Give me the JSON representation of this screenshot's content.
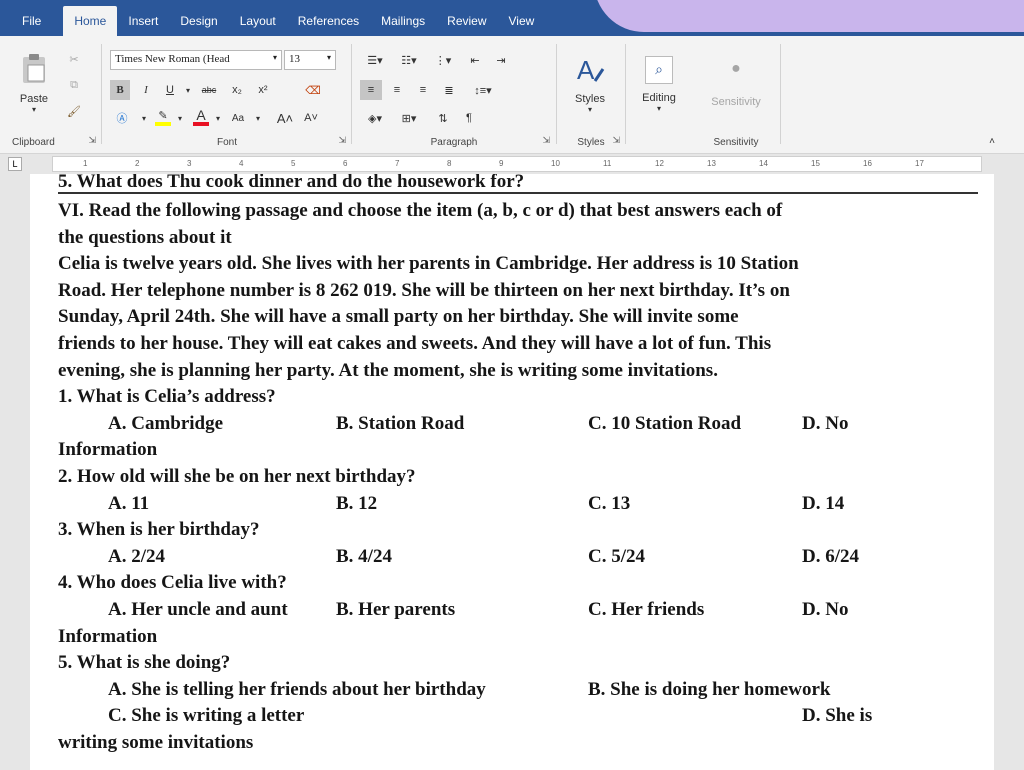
{
  "tabs": [
    "File",
    "Home",
    "Insert",
    "Design",
    "Layout",
    "References",
    "Mailings",
    "Review",
    "View"
  ],
  "ribbon": {
    "clipboard": {
      "paste_label": "Paste",
      "group_label": "Clipboard"
    },
    "font": {
      "font_name": "Times New Roman (Head",
      "font_size": "13",
      "group_label": "Font",
      "bold": "B",
      "italic": "I",
      "underline": "U",
      "strikethrough": "abc",
      "subscript": "x₂",
      "superscript": "x²",
      "font_color": "A",
      "change_case": "Aa"
    },
    "paragraph": {
      "group_label": "Paragraph",
      "pilcrow": "¶"
    },
    "styles": {
      "label": "Styles",
      "group_label": "Styles"
    },
    "editing": {
      "label": "Editing"
    },
    "sensitivity": {
      "label": "Sensitivity",
      "group_label": "Sensitivity"
    },
    "colors": {
      "accent": "#2b579a",
      "highlight": "#ffff00",
      "font_red": "#e81123"
    }
  },
  "ruler": {
    "numbers": [
      "1",
      "2",
      "3",
      "4",
      "5",
      "6",
      "7",
      "8",
      "9",
      "10",
      "11",
      "12",
      "13",
      "14",
      "15",
      "16",
      "17"
    ]
  },
  "document": {
    "cut_line": "5. What does Thu cook dinner and do the housework for?",
    "heading": [
      "VI. Read the following passage and choose the item (a, b, c or d) that best answers each of",
      "the questions about it"
    ],
    "passage": [
      "Celia is twelve years old. She lives with her parents in Cambridge. Her address is 10 Station",
      "Road. Her telephone number is 8 262 019. She will be thirteen on her next birthday. It’s on",
      "Sunday, April 24th. She will have a small party on her birthday. She will invite some",
      "friends to her house. They will eat cakes and sweets. And they will have a lot of fun. This",
      "evening, she is planning her party. At the moment, she is writing some invitations."
    ],
    "questions": [
      {
        "q": "1. What is Celia’s address?",
        "a": "A. Cambridge",
        "b": "B. Station Road",
        "c": "C. 10 Station Road",
        "d": "D. No",
        "wrap": "Information"
      },
      {
        "q": "2. How old will she be on her next birthday?",
        "a": "A. 11",
        "b": "B. 12",
        "c": "C. 13",
        "d": "D. 14",
        "wrap": ""
      },
      {
        "q": "3. When is her birthday?",
        "a": "A. 2/24",
        "b": "B. 4/24",
        "c": "C. 5/24",
        "d": "D. 6/24",
        "wrap": ""
      },
      {
        "q": "4. Who does Celia live with?",
        "a": "A. Her uncle and aunt",
        "b": "B. Her parents",
        "c": "C. Her friends",
        "d": "D. No",
        "wrap": "Information"
      }
    ],
    "q5": {
      "q": "5. What is she doing?",
      "a": "A. She is telling her friends about her birthday",
      "b": "B. She is doing her homework",
      "c": "C. She is writing a letter",
      "d": "D. She is",
      "wrap": "writing some invitations"
    }
  }
}
